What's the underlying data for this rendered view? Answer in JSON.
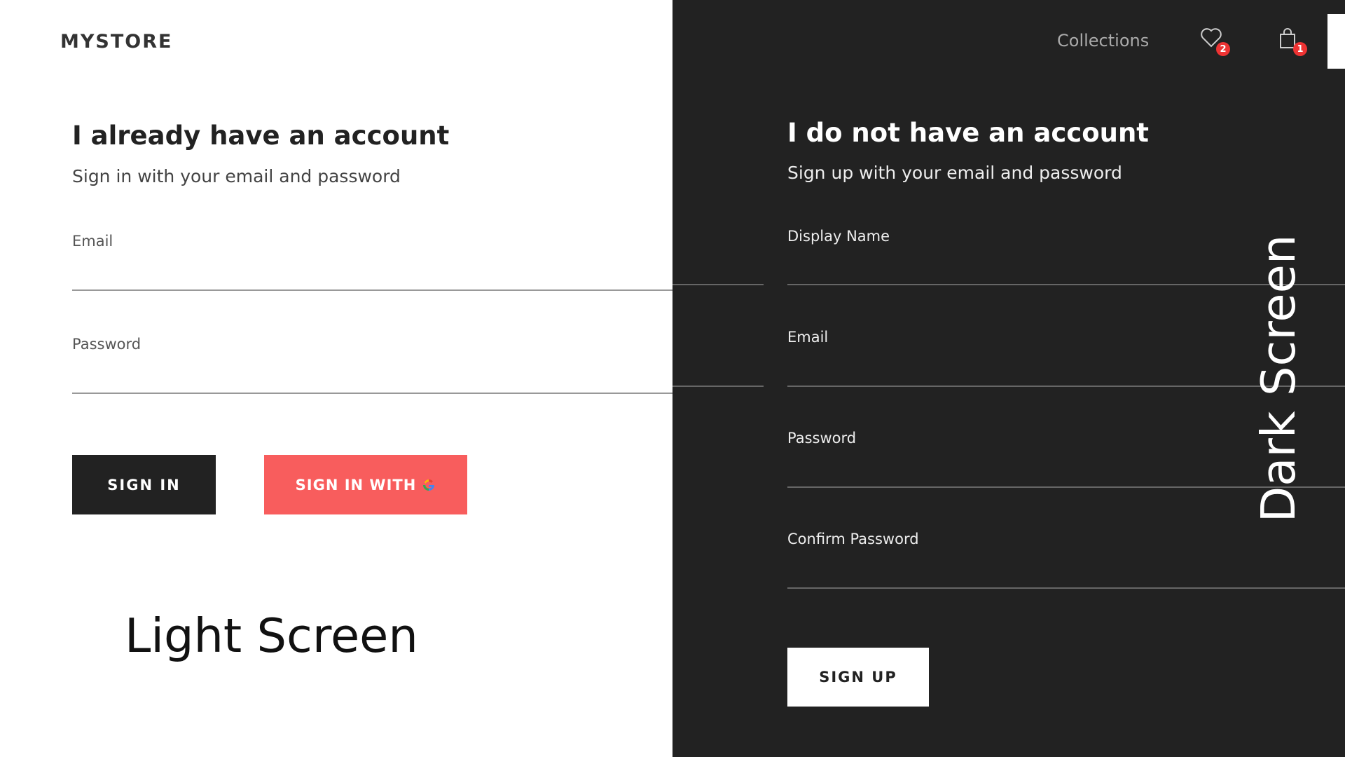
{
  "header": {
    "logo": "MYSTORE",
    "collections_link": "Collections",
    "wishlist_count": "2",
    "cart_count": "1",
    "icons": {
      "wishlist": "heart-icon",
      "cart": "shopping-bag-icon"
    }
  },
  "signin": {
    "title": "I already have an account",
    "subtitle": "Sign in with your email and password",
    "email_label": "Email",
    "email_value": "",
    "password_label": "Password",
    "password_value": "",
    "signin_button": "SIGN IN",
    "google_button": "SIGN IN WITH",
    "google_icon": "google-icon"
  },
  "signup": {
    "title": "I do not have an account",
    "subtitle": "Sign up with your email and password",
    "display_name_label": "Display Name",
    "display_name_value": "",
    "email_label": "Email",
    "email_value": "",
    "password_label": "Password",
    "password_value": "",
    "confirm_password_label": "Confirm Password",
    "confirm_password_value": "",
    "signup_button": "SIGN UP"
  },
  "captions": {
    "light": "Light Screen",
    "dark": "Dark Screen"
  },
  "colors": {
    "light_bg": "#ffffff",
    "dark_bg": "#222222",
    "google_button": "#f85d5d",
    "badge": "#e33333"
  }
}
